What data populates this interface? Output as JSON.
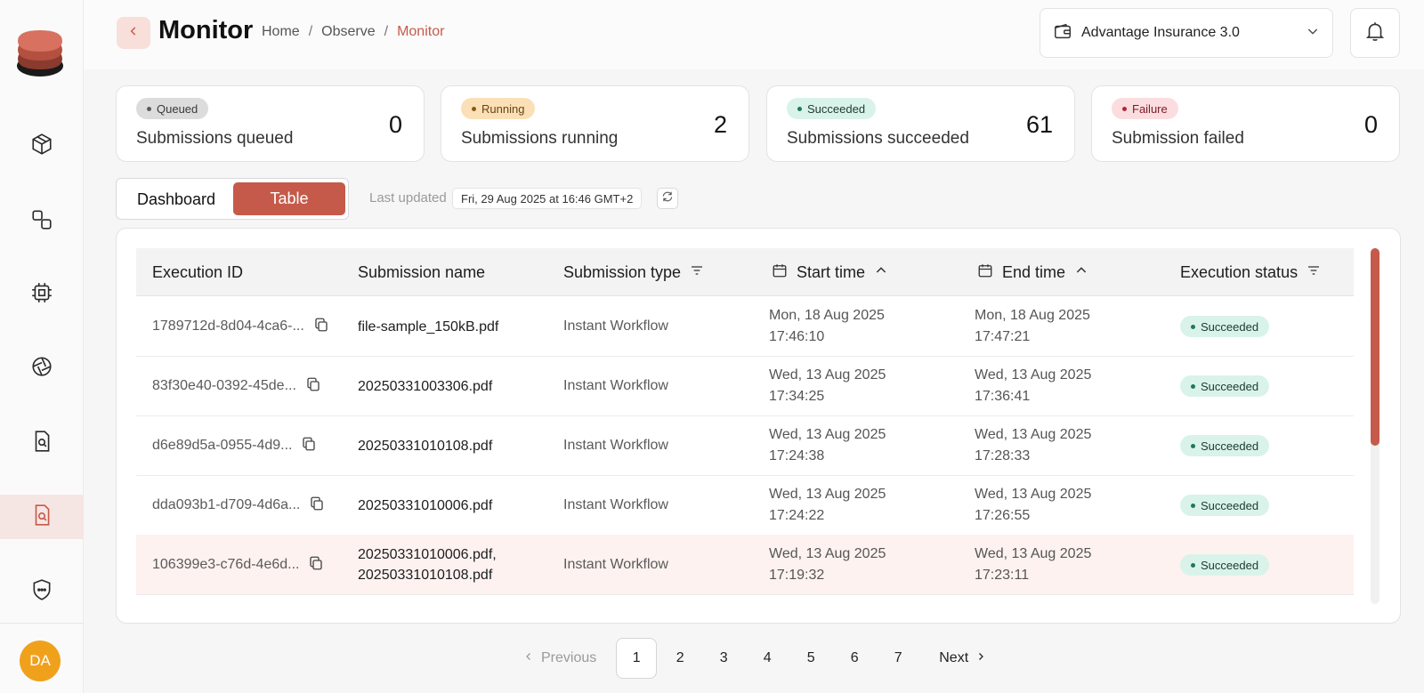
{
  "header": {
    "title": "Monitor",
    "breadcrumb": [
      "Home",
      "Observe",
      "Monitor"
    ],
    "project": "Advantage Insurance 3.0"
  },
  "user": {
    "initials": "DA"
  },
  "stats": [
    {
      "badge": "Queued",
      "label": "Submissions queued",
      "value": "0",
      "badge_bg": "#dcdcdc",
      "badge_fg": "#3a3a3a",
      "dot": "#5a5a5a"
    },
    {
      "badge": "Running",
      "label": "Submissions running",
      "value": "2",
      "badge_bg": "#fbe0b7",
      "badge_fg": "#6a4410",
      "dot": "#8a5a10"
    },
    {
      "badge": "Succeeded",
      "label": "Submissions succeeded",
      "value": "61",
      "badge_bg": "#d9f3ea",
      "badge_fg": "#1b3a2e",
      "dot": "#1e7a54"
    },
    {
      "badge": "Failure",
      "label": "Submission failed",
      "value": "0",
      "badge_bg": "#fbdde0",
      "badge_fg": "#7a1c26",
      "dot": "#b0283a"
    }
  ],
  "view_toggle": {
    "dashboard": "Dashboard",
    "table": "Table",
    "active": "Table"
  },
  "last_updated": {
    "label": "Last updated",
    "value": "Fri, 29 Aug 2025 at 16:46 GMT+2"
  },
  "table": {
    "columns": [
      "Execution ID",
      "Submission name",
      "Submission type",
      "Start time",
      "End time",
      "Execution status"
    ],
    "rows": [
      {
        "id": "1789712d-8d04-4ca6-...",
        "name": [
          "file-sample_150kB.pdf"
        ],
        "type": "Instant Workflow",
        "start_date": "Mon, 18 Aug 2025",
        "start_time": "17:46:10",
        "end_date": "Mon, 18 Aug 2025",
        "end_time": "17:47:21",
        "status": "Succeeded"
      },
      {
        "id": "83f30e40-0392-45de...",
        "name": [
          "20250331003306.pdf"
        ],
        "type": "Instant Workflow",
        "start_date": "Wed, 13 Aug 2025",
        "start_time": "17:34:25",
        "end_date": "Wed, 13 Aug 2025",
        "end_time": "17:36:41",
        "status": "Succeeded"
      },
      {
        "id": "d6e89d5a-0955-4d9...",
        "name": [
          "20250331010108.pdf"
        ],
        "type": "Instant Workflow",
        "start_date": "Wed, 13 Aug 2025",
        "start_time": "17:24:38",
        "end_date": "Wed, 13 Aug 2025",
        "end_time": "17:28:33",
        "status": "Succeeded"
      },
      {
        "id": "dda093b1-d709-4d6a...",
        "name": [
          "20250331010006.pdf"
        ],
        "type": "Instant Workflow",
        "start_date": "Wed, 13 Aug 2025",
        "start_time": "17:24:22",
        "end_date": "Wed, 13 Aug 2025",
        "end_time": "17:26:55",
        "status": "Succeeded"
      },
      {
        "id": "106399e3-c76d-4e6d...",
        "name": [
          "20250331010006.pdf,",
          "20250331010108.pdf"
        ],
        "type": "Instant Workflow",
        "start_date": "Wed, 13 Aug 2025",
        "start_time": "17:19:32",
        "end_date": "Wed, 13 Aug 2025",
        "end_time": "17:23:11",
        "status": "Succeeded"
      }
    ]
  },
  "pagination": {
    "previous": "Previous",
    "next": "Next",
    "pages": [
      "1",
      "2",
      "3",
      "4",
      "5",
      "6",
      "7"
    ],
    "current": "1"
  },
  "colors": {
    "accent": "#c65a4a",
    "accent_soft": "#f8dfda",
    "avatar": "#f0a11c",
    "success_bg": "#d9f3ea"
  },
  "icons": {
    "sidebar": [
      "cube-icon",
      "link-nodes-icon",
      "chip-icon",
      "aperture-icon",
      "document-search-icon",
      "document-search-active-icon",
      "shield-chat-icon"
    ],
    "header": [
      "back-chevron-icon",
      "wallet-icon",
      "chevron-down-icon",
      "bell-icon"
    ],
    "table": [
      "copy-icon",
      "filter-icon",
      "calendar-icon",
      "sort-up-icon"
    ]
  }
}
